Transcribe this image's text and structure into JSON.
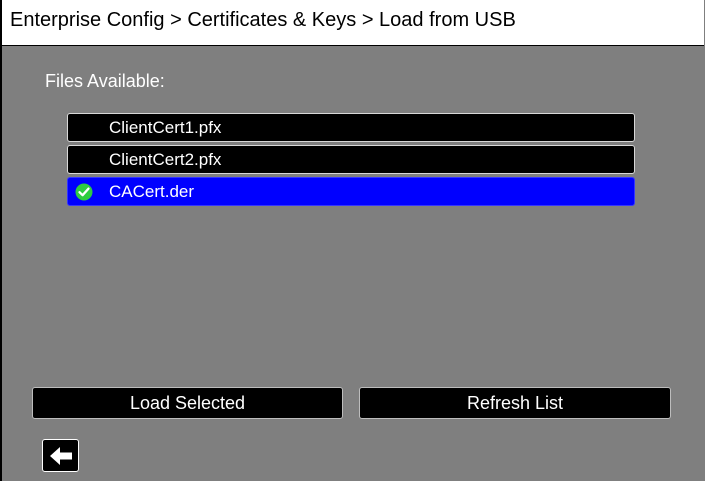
{
  "header": {
    "breadcrumb": "Enterprise Config > Certificates & Keys > Load from USB"
  },
  "files_section": {
    "label": "Files Available:",
    "files": [
      {
        "name": "ClientCert1.pfx",
        "selected": false
      },
      {
        "name": "ClientCert2.pfx",
        "selected": false
      },
      {
        "name": "CACert.der",
        "selected": true
      }
    ]
  },
  "actions": {
    "load_selected": "Load Selected",
    "refresh_list": "Refresh List"
  },
  "navigation": {
    "back_icon": "left-arrow-icon"
  },
  "colors": {
    "screen_background": "#7f7f7f",
    "title_background": "#ffffff",
    "row_background": "#000000",
    "selected_row": "#0000ff",
    "check_badge": "#2ecc40"
  }
}
